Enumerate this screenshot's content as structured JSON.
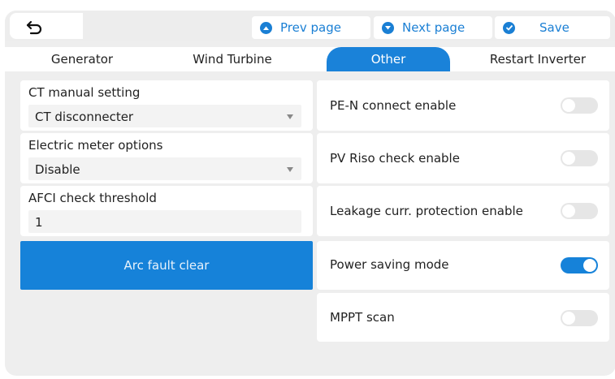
{
  "toolbar": {
    "prev_label": "Prev page",
    "next_label": "Next page",
    "save_label": "Save"
  },
  "tabs": [
    {
      "label": "Generator",
      "active": false
    },
    {
      "label": "Wind Turbine",
      "active": false
    },
    {
      "label": "Other",
      "active": true
    },
    {
      "label": "Restart Inverter",
      "active": false
    }
  ],
  "left": {
    "ct": {
      "label": "CT manual setting",
      "value": "CT disconnecter"
    },
    "meter": {
      "label": "Electric meter options",
      "value": "Disable"
    },
    "afci": {
      "label": "AFCI check threshold",
      "value": "1"
    },
    "arc_button": "Arc fault clear"
  },
  "switches": [
    {
      "label": "PE-N connect enable",
      "on": false
    },
    {
      "label": "PV Riso check enable",
      "on": false
    },
    {
      "label": "Leakage curr. protection enable",
      "on": false
    },
    {
      "label": "Power saving mode",
      "on": true
    },
    {
      "label": "MPPT scan",
      "on": false
    }
  ],
  "colors": {
    "accent": "#1682d9",
    "background": "#eeeeee"
  }
}
